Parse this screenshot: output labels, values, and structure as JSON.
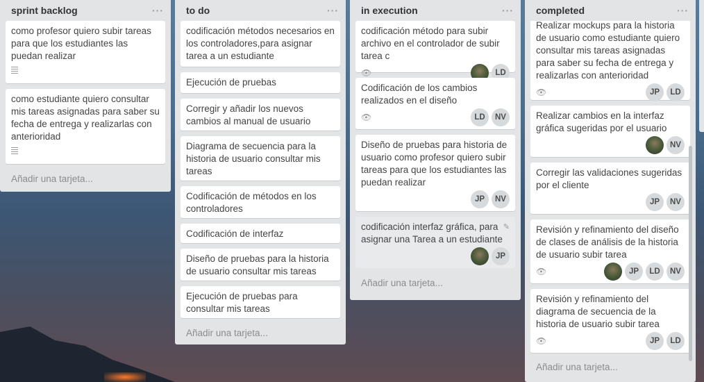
{
  "lists": [
    {
      "title": "sprint backlog",
      "cards": [
        {
          "text": "como profesor quiero subir tareas para que los estudiantes las puedan realizar",
          "description": true
        },
        {
          "text": "como estudiante quiero consultar mis tareas asignadas para saber su fecha de entrega y realizarlas con anterioridad",
          "description": true
        }
      ],
      "add_card": "Añadir una tarjeta..."
    },
    {
      "title": "to do",
      "cards": [
        {
          "text": "codificación métodos necesarios en los controladores,para asignar tarea a un estudiante"
        },
        {
          "text": "Ejecución de pruebas"
        },
        {
          "text": "Corregir y añadir los nuevos cambios al manual de usuario"
        },
        {
          "text": "Diagrama de secuencia para la historia de usuario consultar mis tareas"
        },
        {
          "text": "Codificación de métodos en los controladores"
        },
        {
          "text": "Codificación de interfaz"
        },
        {
          "text": "Diseño de pruebas para la historia de usuario consultar mis tareas"
        },
        {
          "text": "Ejecución de pruebas para consultar mis tareas"
        }
      ],
      "add_card": "Añadir una tarjeta..."
    },
    {
      "title": "in execution",
      "cards": [
        {
          "text": "codificación método para subir archivo en el controlador de subir tarea c",
          "members": [
            "photo",
            "LD"
          ]
        },
        {
          "text": "Codificación de los cambios realizados en el diseño",
          "members": [
            "LD",
            "NV"
          ]
        },
        {
          "text": "Diseño de pruebas para historia de usuario como profesor quiero subir tareas para que los estudiantes las puedan realizar",
          "members": [
            "JP",
            "NV"
          ]
        },
        {
          "text": "codificación interfaz gráfica, para asignar una Tarea a un estudiante",
          "members": [
            "photo",
            "JP"
          ]
        }
      ],
      "add_card": "Añadir una tarjeta..."
    },
    {
      "title": "completed",
      "cards": [
        {
          "text": "Realizar mockups para la historia de usuario como estudiante quiero consultar mis tareas asignadas para saber su fecha de entrega y realizarlas con anterioridad",
          "members": [
            "JP",
            "LD"
          ]
        },
        {
          "text": "Realizar cambios en la interfaz gráfica sugeridas por el usuario",
          "members": [
            "photo",
            "NV"
          ]
        },
        {
          "text": "Corregir las validaciones sugeridas por el cliente",
          "members": [
            "JP",
            "NV"
          ]
        },
        {
          "text": "Revisión y refinamiento del diseño de clases de análisis de la historia de usuario subir tarea",
          "members": [
            "photo",
            "JP",
            "LD",
            "NV"
          ]
        },
        {
          "text": "Revisión y refinamiento del diagrama de secuencia de la historia de usuario subir tarea",
          "members": [
            "JP",
            "LD"
          ]
        }
      ],
      "add_card": "Añadir una tarjeta..."
    }
  ],
  "menu_glyph": "···",
  "icons": {
    "eye": "eye-icon",
    "description": "description-icon",
    "edit": "pencil-icon"
  }
}
